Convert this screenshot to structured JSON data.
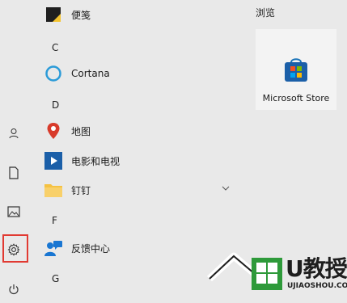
{
  "list": {
    "items": [
      {
        "label": "便笺"
      },
      {
        "header": "C"
      },
      {
        "label": "Cortana"
      },
      {
        "header": "D"
      },
      {
        "label": "地图"
      },
      {
        "label": "电影和电视"
      },
      {
        "label": "钉钉"
      },
      {
        "header": "F"
      },
      {
        "label": "反馈中心"
      },
      {
        "header": "G"
      }
    ]
  },
  "tiles": {
    "title": "浏览",
    "items": [
      {
        "label": "Microsoft Store"
      }
    ]
  },
  "watermark": {
    "brand": "U教授",
    "site": "UJIAOSHOU.COM"
  },
  "colors": {
    "highlight": "#e13a32",
    "cortana": "#2b9bd8",
    "maps": "#d83b2b",
    "movies": "#1b5fa8",
    "dingtalk": "#f5c242",
    "feedback": "#1976d2"
  },
  "icons": [
    "user-icon",
    "document-icon",
    "picture-icon",
    "gear-icon",
    "power-icon"
  ]
}
